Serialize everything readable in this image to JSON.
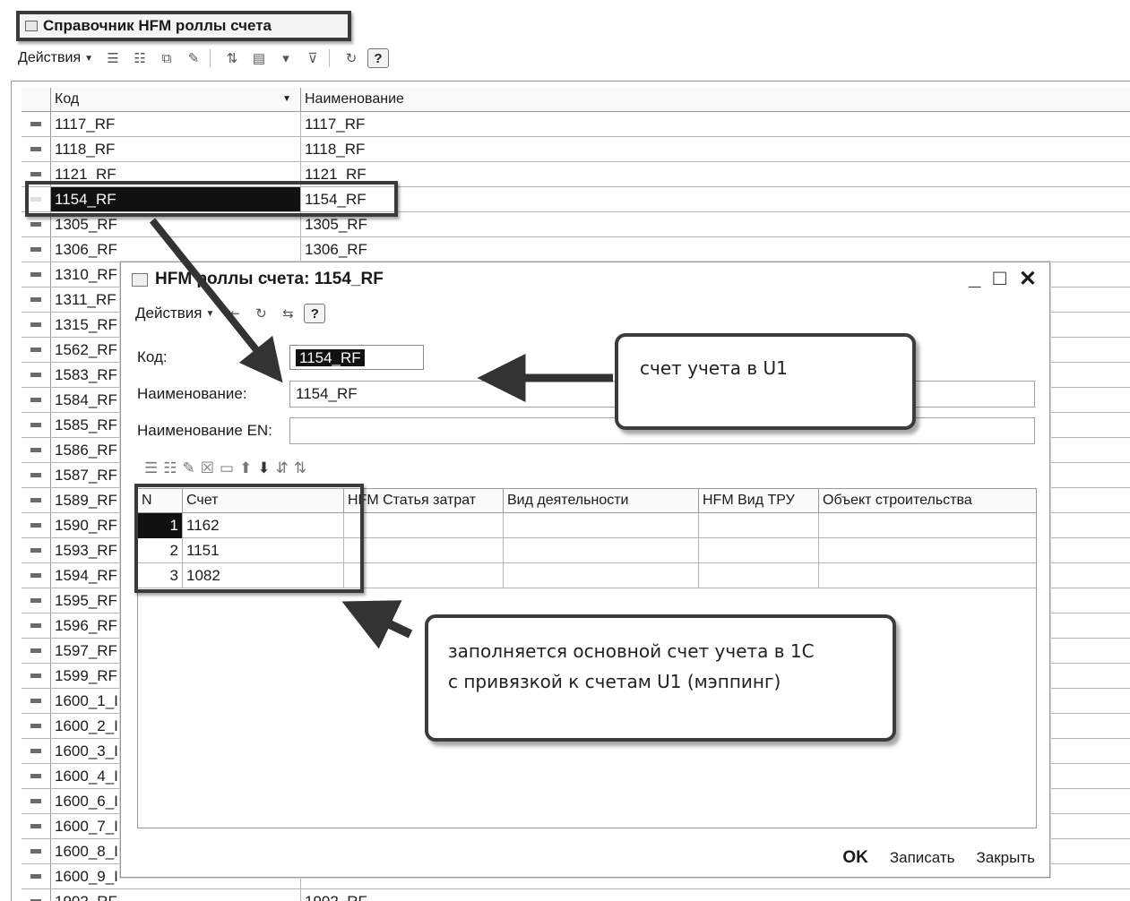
{
  "main_window": {
    "title": "Справочник HFM роллы счета",
    "actions_label": "Действия",
    "columns": {
      "code": "Код",
      "name": "Наименование"
    },
    "rows": [
      {
        "code": "1117_RF",
        "name": "1117_RF"
      },
      {
        "code": "1118_RF",
        "name": "1118_RF"
      },
      {
        "code": "1121_RF",
        "name": "1121_RF"
      },
      {
        "code": "1154_RF",
        "name": "1154_RF"
      },
      {
        "code": "1305_RF",
        "name": "1305_RF"
      },
      {
        "code": "1306_RF",
        "name": "1306_RF"
      },
      {
        "code": "1310_RF",
        "name": ""
      },
      {
        "code": "1311_RF",
        "name": ""
      },
      {
        "code": "1315_RF",
        "name": ""
      },
      {
        "code": "1562_RF",
        "name": ""
      },
      {
        "code": "1583_RF",
        "name": ""
      },
      {
        "code": "1584_RF",
        "name": ""
      },
      {
        "code": "1585_RF",
        "name": ""
      },
      {
        "code": "1586_RF",
        "name": ""
      },
      {
        "code": "1587_RF",
        "name": ""
      },
      {
        "code": "1589_RF",
        "name": ""
      },
      {
        "code": "1590_RF",
        "name": ""
      },
      {
        "code": "1593_RF",
        "name": ""
      },
      {
        "code": "1594_RF",
        "name": ""
      },
      {
        "code": "1595_RF",
        "name": ""
      },
      {
        "code": "1596_RF",
        "name": ""
      },
      {
        "code": "1597_RF",
        "name": ""
      },
      {
        "code": "1599_RF",
        "name": ""
      },
      {
        "code": "1600_1_I",
        "name": ""
      },
      {
        "code": "1600_2_I",
        "name": ""
      },
      {
        "code": "1600_3_I",
        "name": ""
      },
      {
        "code": "1600_4_I",
        "name": ""
      },
      {
        "code": "1600_6_I",
        "name": ""
      },
      {
        "code": "1600_7_I",
        "name": ""
      },
      {
        "code": "1600_8_I",
        "name": ""
      },
      {
        "code": "1600_9_I",
        "name": ""
      },
      {
        "code": "1902_RF",
        "name": "1902_RF"
      }
    ],
    "selected_row": "1154_RF"
  },
  "dialog": {
    "title": "HFM роллы счета: 1154_RF",
    "actions_label": "Действия",
    "code_label": "Код:",
    "code_value": "1154_RF",
    "name_label": "Наименование:",
    "name_value": "1154_RF",
    "name_en_label": "Наименование EN:",
    "name_en_value": "",
    "table": {
      "columns": [
        "N",
        "Счет",
        "HFM Статья затрат",
        "Вид деятельности",
        "HFM Вид ТРУ",
        "Объект строительства"
      ],
      "rows": [
        {
          "n": "1",
          "account": "1162"
        },
        {
          "n": "2",
          "account": "1151"
        },
        {
          "n": "3",
          "account": "1082"
        }
      ]
    },
    "buttons": {
      "ok": "OK",
      "save": "Записать",
      "close": "Закрыть"
    }
  },
  "callouts": {
    "account_u1": "счет учета в U1",
    "mapping_line1": "заполняется основной счет учета в 1С",
    "mapping_line2": "с привязкой к счетам U1 (мэппинг)"
  },
  "icons": [
    "list-add-icon",
    "group-add-icon",
    "copy-icon",
    "edit-icon",
    "sort-icon",
    "filter-icon",
    "clear-filter-icon",
    "refresh-icon",
    "help-icon",
    "move-up-icon",
    "move-down-icon",
    "sort-asc-icon",
    "sort-desc-icon",
    "window-icon",
    "minimize-icon",
    "maximize-icon",
    "close-icon"
  ]
}
